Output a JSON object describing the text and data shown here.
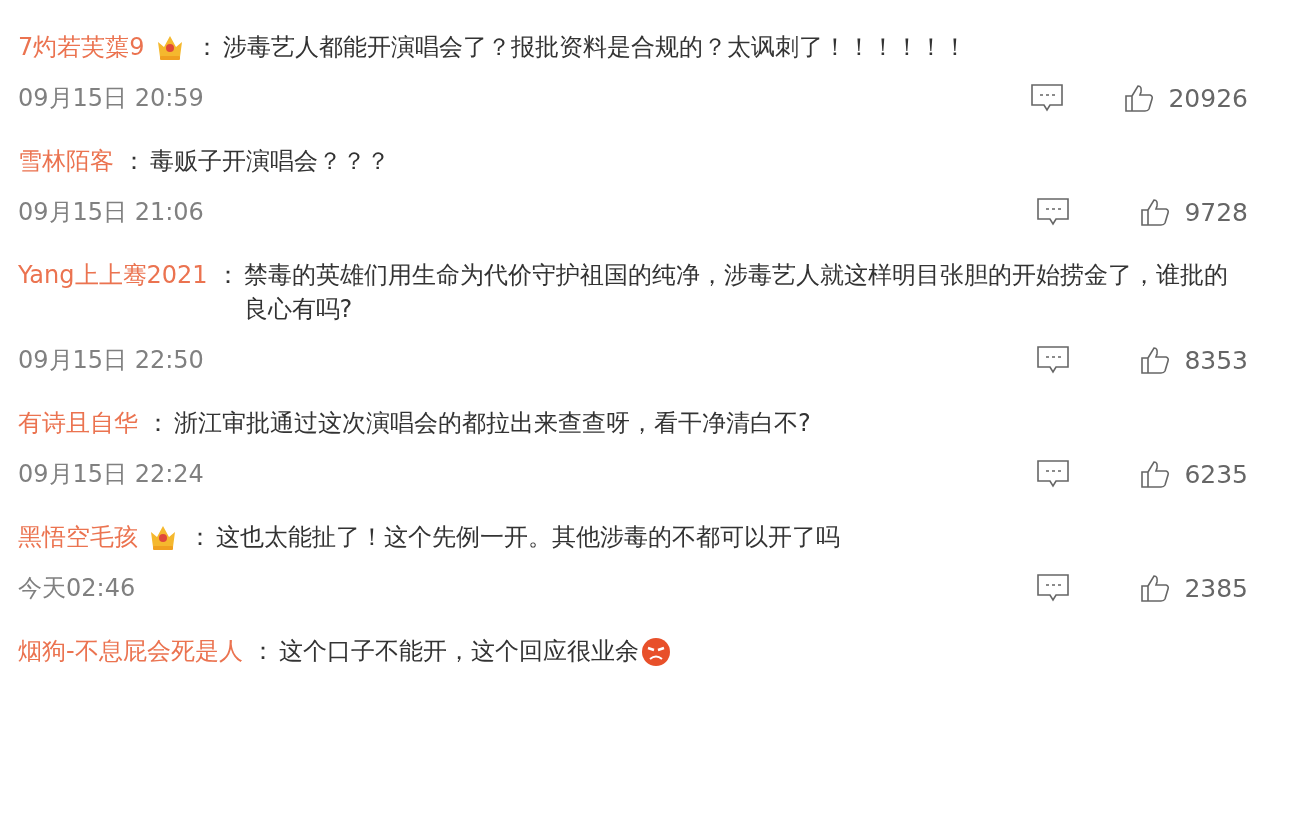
{
  "comments": [
    {
      "user": "7灼若芙蕖9",
      "badge": true,
      "colon": "：",
      "text": "涉毒艺人都能开演唱会了？报批资料是合规的？太讽刺了！！！！！！",
      "emoji": false,
      "time": "09月15日 20:59",
      "likes": "20926"
    },
    {
      "user": "雪林陌客",
      "badge": false,
      "colon": "：",
      "text": "毒贩子开演唱会？？？",
      "emoji": false,
      "time": "09月15日 21:06",
      "likes": "9728"
    },
    {
      "user": "Yang上上骞2021",
      "badge": false,
      "colon": "：",
      "text": "禁毒的英雄们用生命为代价守护祖国的纯净，涉毒艺人就这样明目张胆的开始捞金了，谁批的良心有吗?",
      "emoji": false,
      "time": "09月15日 22:50",
      "likes": "8353"
    },
    {
      "user": "有诗且自华",
      "badge": false,
      "colon": "：",
      "text": "浙江审批通过这次演唱会的都拉出来查查呀，看干净清白不?",
      "emoji": false,
      "time": "09月15日 22:24",
      "likes": "6235"
    },
    {
      "user": "黑悟空毛孩",
      "badge": true,
      "colon": "：",
      "text": "这也太能扯了！这个先例一开。其他涉毒的不都可以开了吗",
      "emoji": false,
      "time": "今天02:46",
      "likes": "2385"
    },
    {
      "user": "烟狗-不息屁会死是人",
      "badge": false,
      "colon": "：",
      "text": "这个口子不能开，这个回应很业余",
      "emoji": true
    }
  ]
}
